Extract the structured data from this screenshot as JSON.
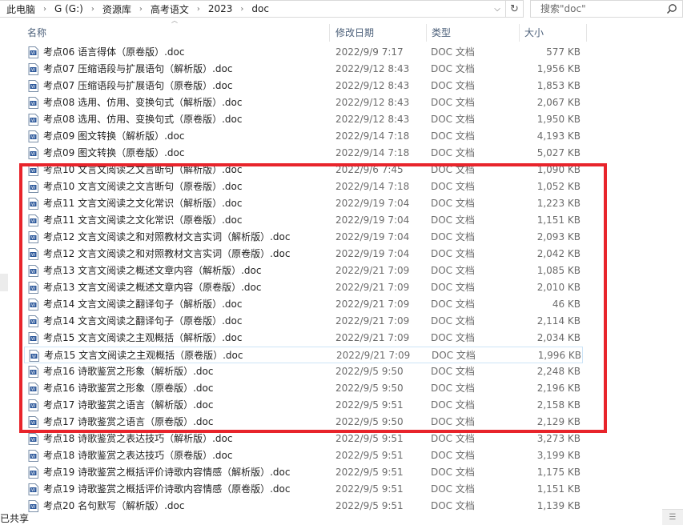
{
  "address": {
    "crumbs": [
      "此电脑",
      "G (G:)",
      "资源库",
      "高考语文",
      "2023",
      "doc"
    ]
  },
  "search": {
    "placeholder": "搜索\"doc\""
  },
  "columns": {
    "name": "名称",
    "date": "修改日期",
    "type": "类型",
    "size": "大小"
  },
  "files": [
    {
      "name": "考点06 语言得体（原卷版）.doc",
      "date": "2022/9/9 7:17",
      "type": "DOC 文档",
      "size": "577 KB"
    },
    {
      "name": "考点07 压缩语段与扩展语句（解析版）.doc",
      "date": "2022/9/12 8:43",
      "type": "DOC 文档",
      "size": "1,956 KB"
    },
    {
      "name": "考点07 压缩语段与扩展语句（原卷版）.doc",
      "date": "2022/9/12 8:43",
      "type": "DOC 文档",
      "size": "1,853 KB"
    },
    {
      "name": "考点08 选用、仿用、变换句式（解析版）.doc",
      "date": "2022/9/12 8:43",
      "type": "DOC 文档",
      "size": "2,067 KB"
    },
    {
      "name": "考点08 选用、仿用、变换句式（原卷版）.doc",
      "date": "2022/9/12 8:43",
      "type": "DOC 文档",
      "size": "1,950 KB"
    },
    {
      "name": "考点09 图文转换（解析版）.doc",
      "date": "2022/9/14 7:18",
      "type": "DOC 文档",
      "size": "4,193 KB"
    },
    {
      "name": "考点09 图文转换（原卷版）.doc",
      "date": "2022/9/14 7:18",
      "type": "DOC 文档",
      "size": "5,027 KB"
    },
    {
      "name": "考点10 文言文阅读之文言断句（解析版）.doc",
      "date": "2022/9/6 7:45",
      "type": "DOC 文档",
      "size": "1,090 KB"
    },
    {
      "name": "考点10 文言文阅读之文言断句（原卷版）.doc",
      "date": "2022/9/14 7:18",
      "type": "DOC 文档",
      "size": "1,052 KB"
    },
    {
      "name": "考点11 文言文阅读之文化常识（解析版）.doc",
      "date": "2022/9/19 7:04",
      "type": "DOC 文档",
      "size": "1,223 KB"
    },
    {
      "name": "考点11 文言文阅读之文化常识（原卷版）.doc",
      "date": "2022/9/19 7:04",
      "type": "DOC 文档",
      "size": "1,151 KB"
    },
    {
      "name": "考点12 文言文阅读之和对照教材文言实词（解析版）.doc",
      "date": "2022/9/19 7:04",
      "type": "DOC 文档",
      "size": "2,093 KB"
    },
    {
      "name": "考点12 文言文阅读之和对照教材文言实词（原卷版）.doc",
      "date": "2022/9/19 7:04",
      "type": "DOC 文档",
      "size": "2,042 KB"
    },
    {
      "name": "考点13 文言文阅读之概述文章内容（解析版）.doc",
      "date": "2022/9/21 7:09",
      "type": "DOC 文档",
      "size": "1,085 KB"
    },
    {
      "name": "考点13 文言文阅读之概述文章内容（原卷版）.doc",
      "date": "2022/9/21 7:09",
      "type": "DOC 文档",
      "size": "2,010 KB"
    },
    {
      "name": "考点14 文言文阅读之翻译句子（解析版）.doc",
      "date": "2022/9/21 7:09",
      "type": "DOC 文档",
      "size": "46 KB"
    },
    {
      "name": "考点14 文言文阅读之翻译句子（原卷版）.doc",
      "date": "2022/9/21 7:09",
      "type": "DOC 文档",
      "size": "2,114 KB"
    },
    {
      "name": "考点15 文言文阅读之主观概括（解析版）.doc",
      "date": "2022/9/21 7:09",
      "type": "DOC 文档",
      "size": "2,034 KB"
    },
    {
      "name": "考点15 文言文阅读之主观概括（原卷版）.doc",
      "date": "2022/9/21 7:09",
      "type": "DOC 文档",
      "size": "1,996 KB"
    },
    {
      "name": "考点16 诗歌鉴赏之形象（解析版）.doc",
      "date": "2022/9/5 9:50",
      "type": "DOC 文档",
      "size": "2,248 KB"
    },
    {
      "name": "考点16 诗歌鉴赏之形象（原卷版）.doc",
      "date": "2022/9/5 9:50",
      "type": "DOC 文档",
      "size": "2,196 KB"
    },
    {
      "name": "考点17 诗歌鉴赏之语言（解析版）.doc",
      "date": "2022/9/5 9:51",
      "type": "DOC 文档",
      "size": "2,158 KB"
    },
    {
      "name": "考点17 诗歌鉴赏之语言（原卷版）.doc",
      "date": "2022/9/5 9:50",
      "type": "DOC 文档",
      "size": "2,129 KB"
    },
    {
      "name": "考点18 诗歌鉴赏之表达技巧（解析版）.doc",
      "date": "2022/9/5 9:51",
      "type": "DOC 文档",
      "size": "3,273 KB"
    },
    {
      "name": "考点18 诗歌鉴赏之表达技巧（原卷版）.doc",
      "date": "2022/9/5 9:51",
      "type": "DOC 文档",
      "size": "3,199 KB"
    },
    {
      "name": "考点19 诗歌鉴赏之概括评价诗歌内容情感（解析版）.doc",
      "date": "2022/9/5 9:51",
      "type": "DOC 文档",
      "size": "1,175 KB"
    },
    {
      "name": "考点19 诗歌鉴赏之概括评价诗歌内容情感（原卷版）.doc",
      "date": "2022/9/5 9:51",
      "type": "DOC 文档",
      "size": "1,151 KB"
    },
    {
      "name": "考点20 名句默写（解析版）.doc",
      "date": "2022/9/5 9:51",
      "type": "DOC 文档",
      "size": "1,139 KB"
    }
  ],
  "hover_index": 18,
  "status": {
    "text": "已共享"
  },
  "colors": {
    "highlight": "#e8242b",
    "header_text": "#4c607a",
    "hover_border": "#cce4f7",
    "doc_icon": "#2b579a"
  }
}
